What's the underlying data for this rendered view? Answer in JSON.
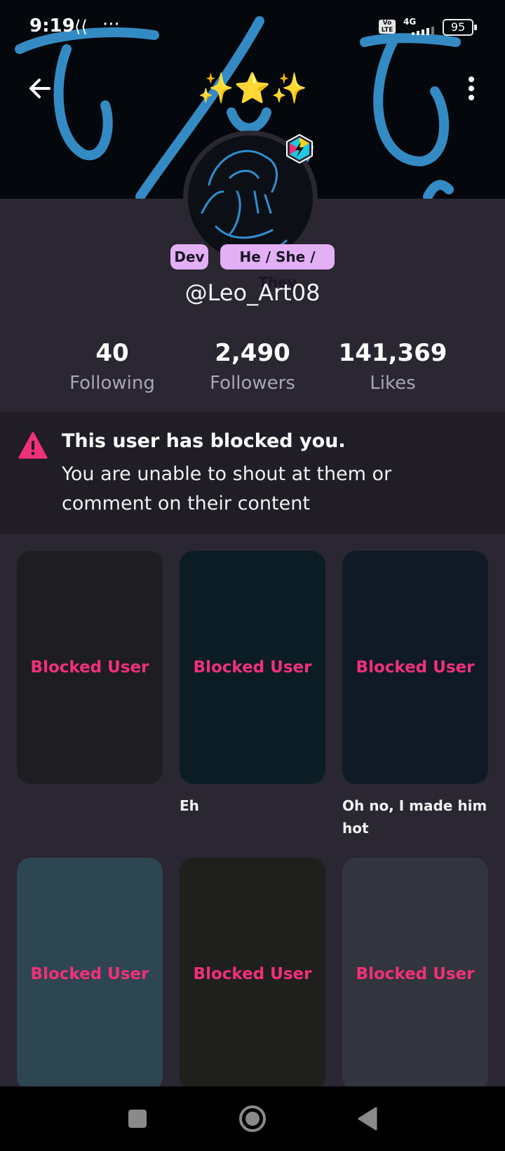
{
  "status_bar": {
    "time": "9:19",
    "dots": "···",
    "volte": "Vo LTE",
    "network": "4G",
    "battery": "95"
  },
  "header": {
    "title_emoji": "✨⭐✨"
  },
  "profile": {
    "tags": [
      "Dev",
      "He / She / They"
    ],
    "username": "@Leo_Art08"
  },
  "stats": [
    {
      "value": "40",
      "label": "Following"
    },
    {
      "value": "2,490",
      "label": "Followers"
    },
    {
      "value": "141,369",
      "label": "Likes"
    }
  ],
  "notice": {
    "title": "This user has blocked you.",
    "text": "You are unable to shout at them or comment on their content"
  },
  "posts": [
    {
      "label": "Blocked User",
      "caption": "",
      "color": "#1e1d22"
    },
    {
      "label": "Blocked User",
      "caption": "Eh",
      "color": "#0b1c24"
    },
    {
      "label": "Blocked User",
      "caption": "Oh no, I made him hot",
      "color": "#0f1a26"
    },
    {
      "label": "Blocked User",
      "caption": "",
      "color": "#2e4552"
    },
    {
      "label": "Blocked User",
      "caption": "",
      "color": "#1f201d"
    },
    {
      "label": "Blocked User",
      "caption": "",
      "color": "#33353e"
    }
  ],
  "colors": {
    "accent_pink": "#f0307a",
    "tag_bg": "#e3b0f5",
    "background": "#2a2632",
    "notice_bg": "#201d26"
  }
}
